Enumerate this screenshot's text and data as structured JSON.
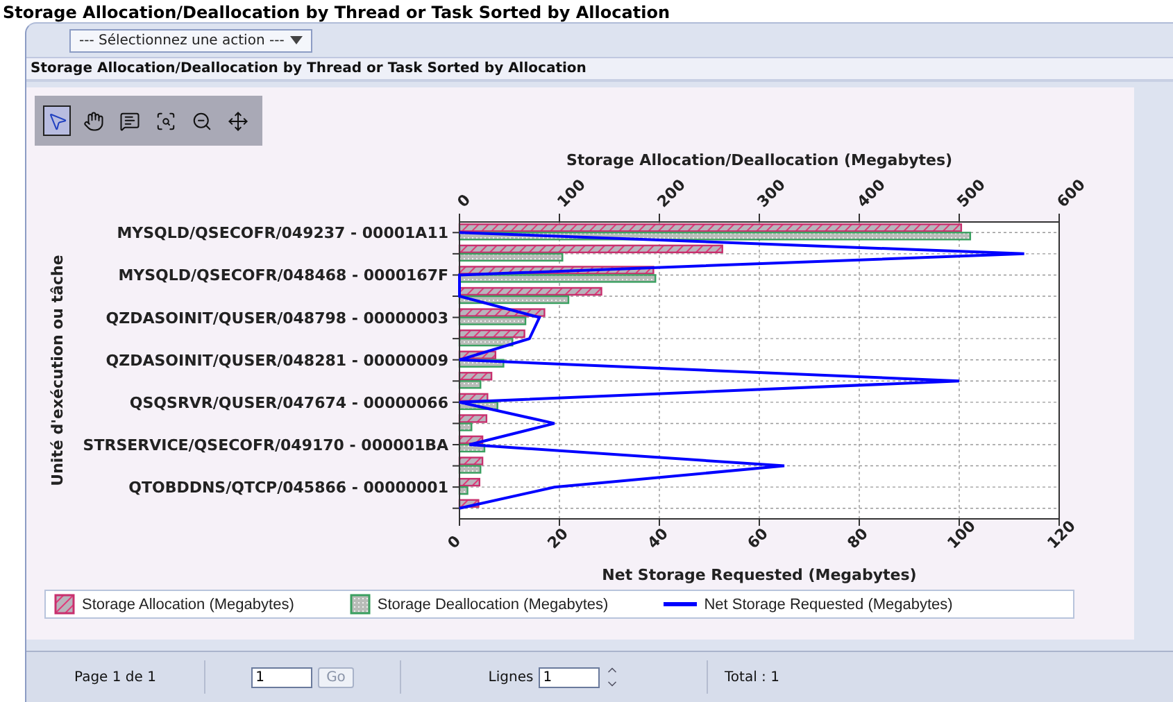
{
  "page_title": "Storage Allocation/Deallocation by Thread or Task Sorted by Allocation",
  "action_menu": {
    "label": "--- Sélectionnez une action ---"
  },
  "section_title": "Storage Allocation/Deallocation by Thread or Task Sorted by Allocation",
  "chart_tools": [
    {
      "kind": "select",
      "selected": true
    },
    {
      "kind": "pan",
      "selected": false
    },
    {
      "kind": "tooltip",
      "selected": false
    },
    {
      "kind": "zoom-box",
      "selected": false
    },
    {
      "kind": "zoom-out",
      "selected": false
    },
    {
      "kind": "fit",
      "selected": false
    }
  ],
  "chart": {
    "chart_data": {
      "type": "bar",
      "orientation": "horizontal",
      "grid": true,
      "xlabel": "Storage Allocation/Deallocation (Megabytes)",
      "ylabel": "Unité d'exécution ou tâche",
      "xlim": [
        0,
        600
      ],
      "xticks": [
        0,
        100,
        200,
        300,
        400,
        500,
        600
      ],
      "categories": [
        "MYSQLD/QSECOFR/049237 - 00001A11",
        null,
        "MYSQLD/QSECOFR/048468 - 0000167F",
        null,
        "QZDASOINIT/QUSER/048798 - 00000003",
        null,
        "QZDASOINIT/QUSER/048281 - 00000009",
        null,
        "QSQSRVR/QUSER/047674 - 00000066",
        null,
        "STRSERVICE/QSECOFR/049170 - 000001BA",
        null,
        "QTOBDDNS/QTCP/045866 - 00000001",
        null
      ],
      "series": [
        {
          "name": "Storage Allocation (Megabytes)",
          "color": "#c8306e",
          "values": [
            502,
            263,
            194,
            142,
            85,
            65,
            36,
            32,
            28,
            27,
            23,
            23,
            20,
            19
          ]
        },
        {
          "name": "Storage Deallocation (Megabytes)",
          "color": "#3aa060",
          "values": [
            511,
            103,
            196,
            109,
            66,
            53,
            44,
            21,
            38,
            12,
            25,
            21,
            8,
            null
          ]
        }
      ]
    }
  },
  "net_chart": {
    "chart_data": {
      "type": "line",
      "orientation": "horizontal",
      "xlabel": "Net Storage Requested (Megabytes)",
      "xlim": [
        0,
        120
      ],
      "xticks": [
        0,
        20,
        40,
        60,
        80,
        100,
        120
      ],
      "series": [
        {
          "name": "Net Storage Requested (Megabytes)",
          "color": "#0000ff",
          "values": [
            0,
            113,
            0,
            0,
            16,
            14,
            0,
            100,
            0,
            19,
            2,
            65,
            19,
            0
          ]
        }
      ]
    }
  },
  "pagination": {
    "page_info": "Page 1 de 1",
    "page_value": "1",
    "go_label": "Go",
    "rows_label": "Lignes",
    "rows_value": "1",
    "total": "Total : 1"
  }
}
